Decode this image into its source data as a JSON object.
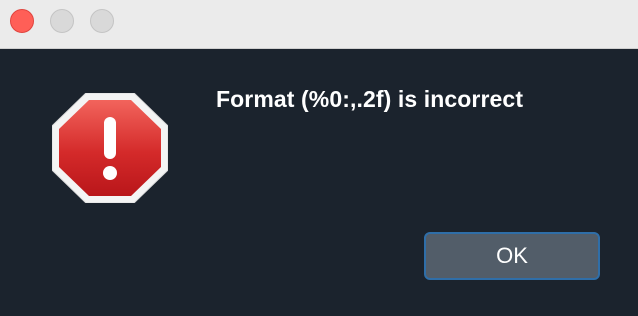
{
  "dialog": {
    "message": "Format (%0:,.2f) is incorrect",
    "ok_label": "OK",
    "icon": "stop-alert-icon"
  },
  "window_controls": {
    "close_color": "#ff5f57",
    "inactive_color": "#d9d9d9"
  },
  "colors": {
    "background": "#1b232d",
    "titlebar": "#ebebeb",
    "button_fill": "#525d69",
    "button_focus_ring": "#2f6ea8",
    "alert_red": "#d42a2a"
  }
}
